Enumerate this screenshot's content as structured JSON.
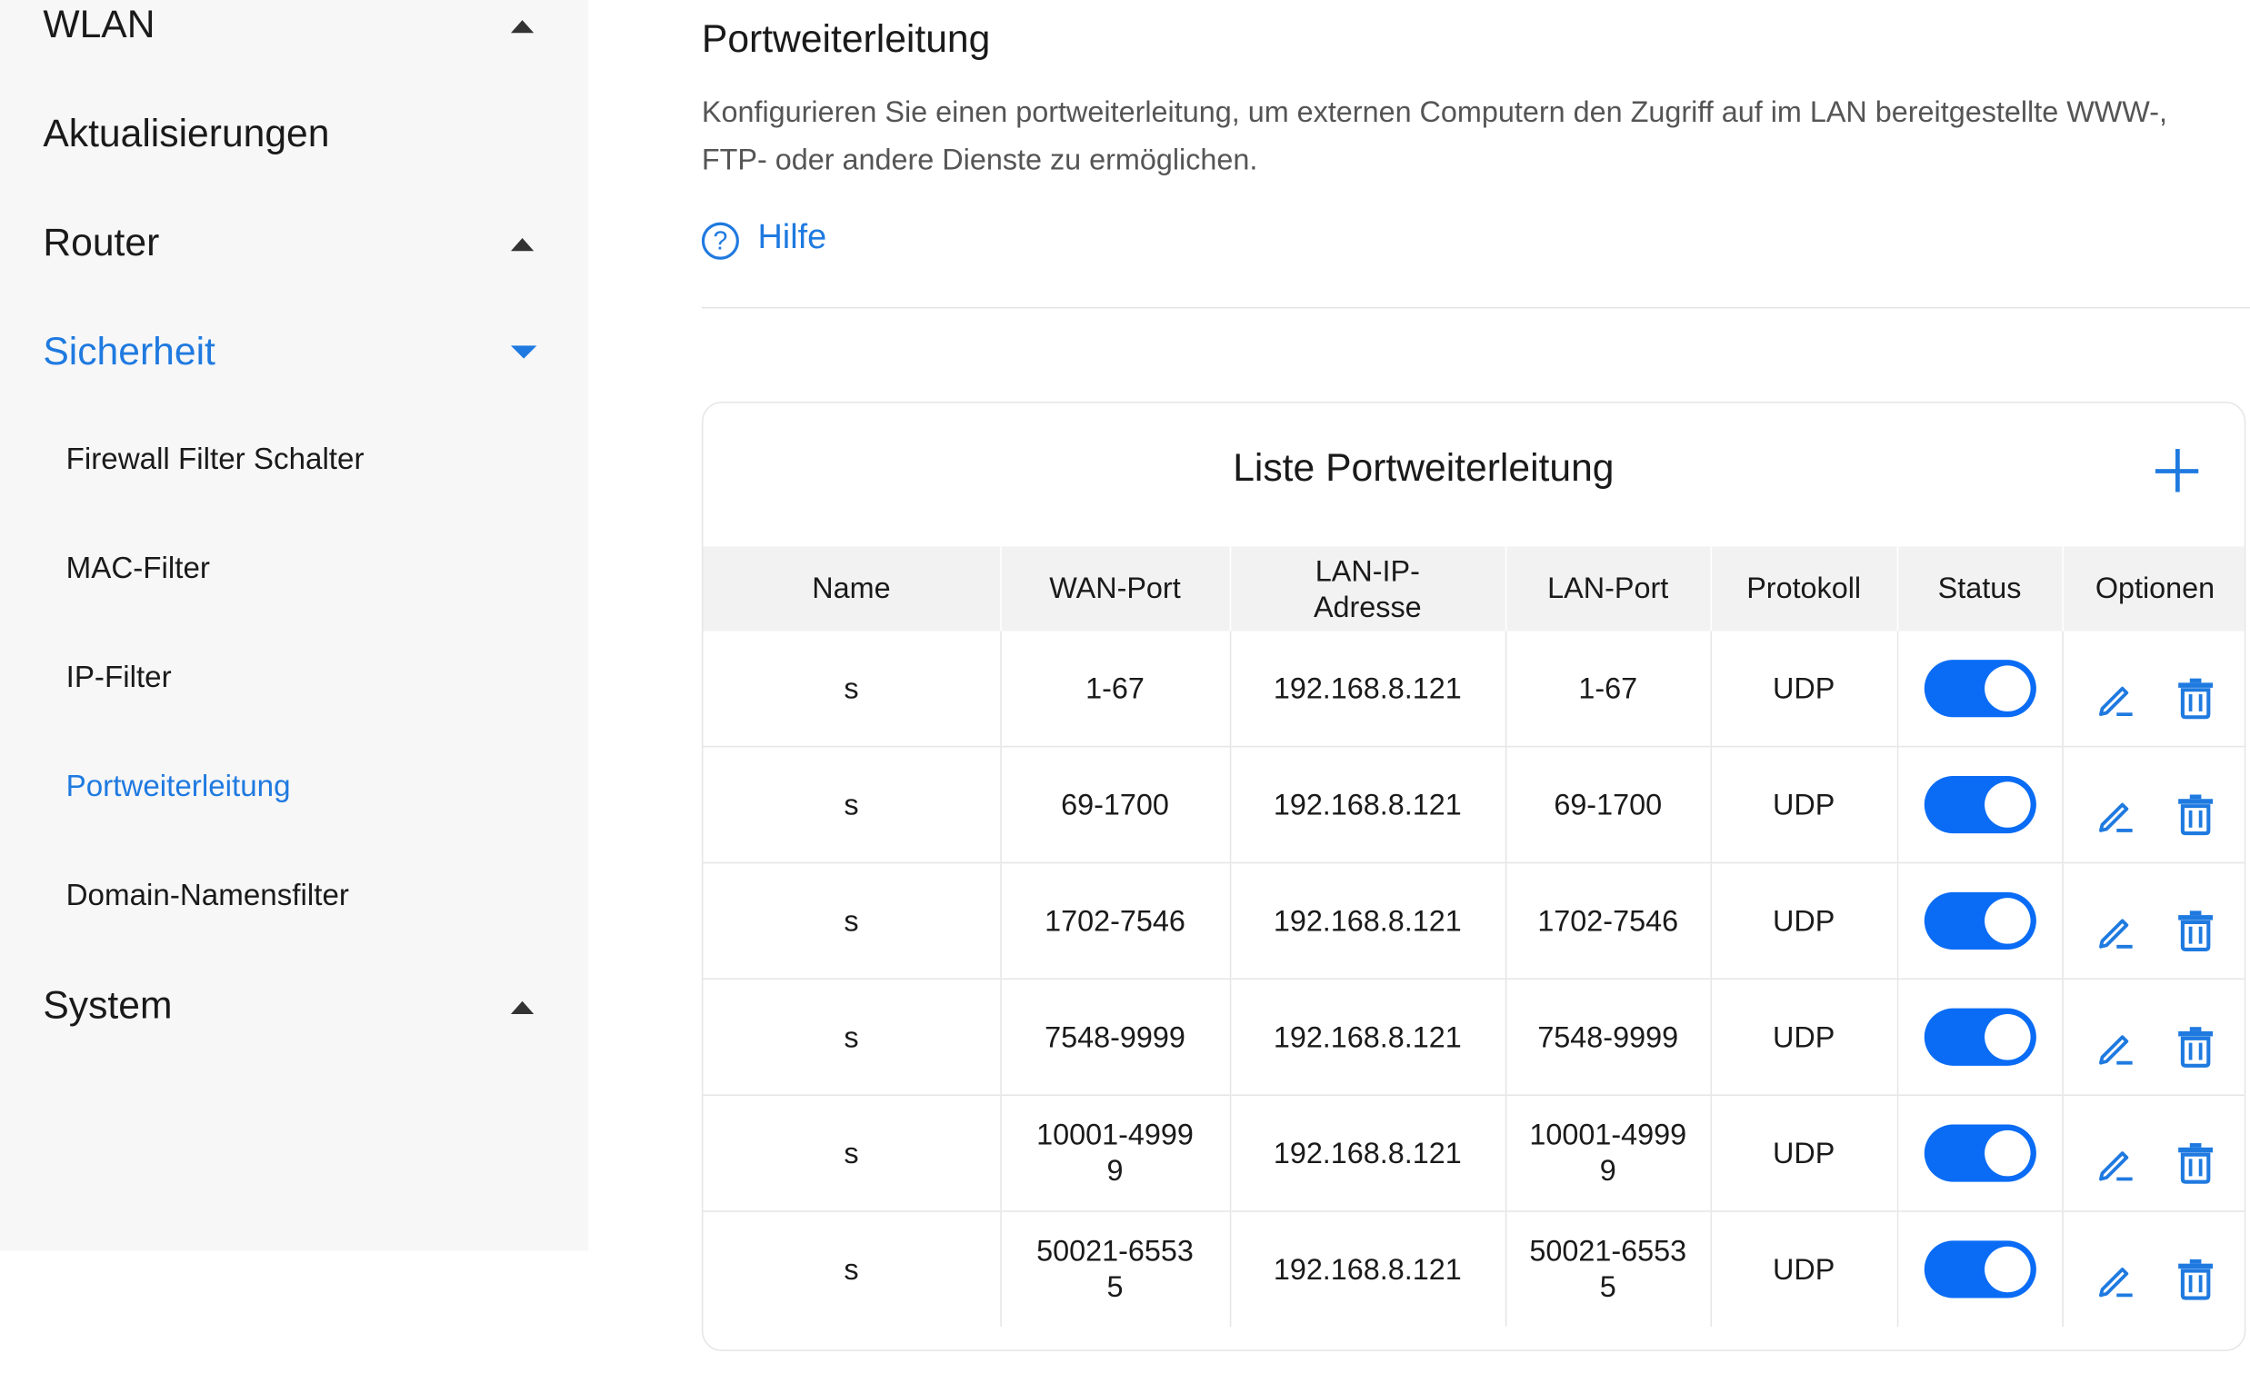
{
  "sidebar": {
    "top_items": [
      {
        "label": "WLAN",
        "expanded": false
      },
      {
        "label": "Aktualisierungen"
      },
      {
        "label": "Router",
        "expanded": false
      },
      {
        "label": "Sicherheit",
        "expanded": true,
        "active": true
      },
      {
        "label": "System",
        "expanded": false
      }
    ],
    "sub_items": [
      {
        "label": "Firewall Filter Schalter"
      },
      {
        "label": "MAC-Filter"
      },
      {
        "label": "IP-Filter"
      },
      {
        "label": "Portweiterleitung",
        "active": true
      },
      {
        "label": "Domain-Namensfilter"
      }
    ]
  },
  "main": {
    "title": "Portweiterleitung",
    "description": "Konfigurieren Sie einen portweiterleitung, um externen Computern den Zugriff auf im LAN bereitgestellte WWW-, FTP- oder andere Dienste zu ermöglichen.",
    "help_label": "Hilfe",
    "help_icon": "?"
  },
  "card": {
    "title": "Liste Portweiterleitung",
    "add_icon": "plus-icon",
    "columns": [
      "Name",
      "WAN-Port",
      "LAN-IP-\nAdresse",
      "LAN-Port",
      "Protokoll",
      "Status",
      "Optionen"
    ],
    "rows": [
      {
        "name": "s",
        "wan_port": "1-67",
        "lan_ip": "192.168.8.121",
        "lan_port": "1-67",
        "protocol": "UDP",
        "enabled": true
      },
      {
        "name": "s",
        "wan_port": "69-1700",
        "lan_ip": "192.168.8.121",
        "lan_port": "69-1700",
        "protocol": "UDP",
        "enabled": true
      },
      {
        "name": "s",
        "wan_port": "1702-7546",
        "lan_ip": "192.168.8.121",
        "lan_port": "1702-7546",
        "protocol": "UDP",
        "enabled": true
      },
      {
        "name": "s",
        "wan_port": "7548-9999",
        "lan_ip": "192.168.8.121",
        "lan_port": "7548-9999",
        "protocol": "UDP",
        "enabled": true
      },
      {
        "name": "s",
        "wan_port": "10001-49999",
        "lan_ip": "192.168.8.121",
        "lan_port": "10001-49999",
        "protocol": "UDP",
        "enabled": true
      },
      {
        "name": "s",
        "wan_port": "50021-65535",
        "lan_ip": "192.168.8.121",
        "lan_port": "50021-65535",
        "protocol": "UDP",
        "enabled": true
      }
    ]
  },
  "colors": {
    "accent": "#1f7ae0",
    "toggle_on": "#0a6cf5",
    "sidebar_bg": "#f7f7f8",
    "header_bg": "#f2f2f2"
  }
}
